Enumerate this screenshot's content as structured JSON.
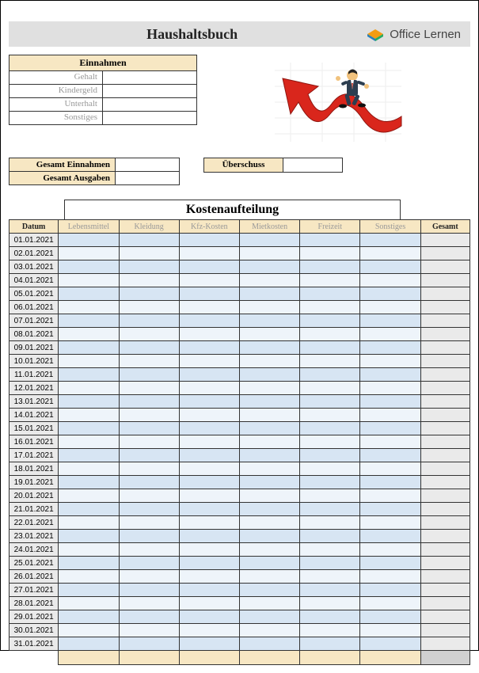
{
  "header": {
    "title": "Haushaltsbuch",
    "brand": "Office Lernen"
  },
  "einnahmen": {
    "header": "Einnahmen",
    "rows": [
      {
        "label": "Gehalt",
        "value": ""
      },
      {
        "label": "Kindergeld",
        "value": ""
      },
      {
        "label": "Unterhalt",
        "value": ""
      },
      {
        "label": "Sonstiges",
        "value": ""
      }
    ]
  },
  "summary": {
    "gesamt_einnahmen_label": "Gesamt Einnahmen",
    "gesamt_einnahmen_value": "",
    "gesamt_ausgaben_label": "Gesamt Ausgaben",
    "gesamt_ausgaben_value": "",
    "ueberschuss_label": "Überschuss",
    "ueberschuss_value": ""
  },
  "kosten": {
    "title": "Kostenaufteilung",
    "columns": {
      "datum": "Datum",
      "lebensmittel": "Lebensmittel",
      "kleidung": "Kleidung",
      "kfz": "Kfz-Kosten",
      "miet": "Mietkosten",
      "freizeit": "Freizeit",
      "sonstiges": "Sonstiges",
      "gesamt": "Gesamt"
    },
    "dates": [
      "01.01.2021",
      "02.01.2021",
      "03.01.2021",
      "04.01.2021",
      "05.01.2021",
      "06.01.2021",
      "07.01.2021",
      "08.01.2021",
      "09.01.2021",
      "10.01.2021",
      "11.01.2021",
      "12.01.2021",
      "13.01.2021",
      "14.01.2021",
      "15.01.2021",
      "16.01.2021",
      "17.01.2021",
      "18.01.2021",
      "19.01.2021",
      "20.01.2021",
      "21.01.2021",
      "22.01.2021",
      "23.01.2021",
      "24.01.2021",
      "25.01.2021",
      "26.01.2021",
      "27.01.2021",
      "28.01.2021",
      "29.01.2021",
      "30.01.2021",
      "31.01.2021"
    ]
  },
  "colors": {
    "header_bg": "#e0e0e0",
    "section_header": "#f7e7c3",
    "row_blue": "#d7e5f3",
    "row_blue_alt": "#eef4fa",
    "grey": "#eaeaea"
  }
}
